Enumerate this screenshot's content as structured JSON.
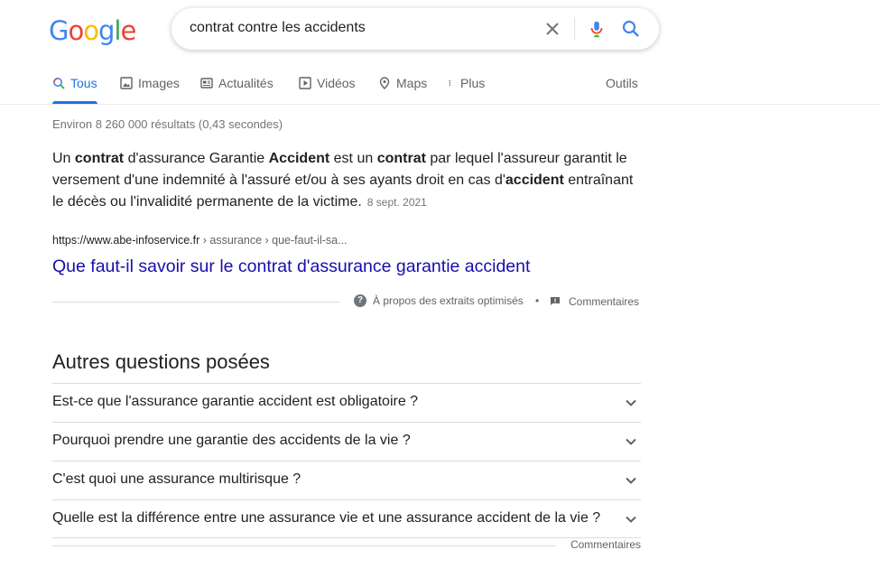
{
  "logo": {
    "text": "Google",
    "letters": [
      "G",
      "o",
      "o",
      "g",
      "l",
      "e"
    ],
    "colors": [
      "#4285f4",
      "#ea4335",
      "#fbbc05",
      "#4285f4",
      "#34a853",
      "#ea4335"
    ]
  },
  "search": {
    "query": "contrat contre les accidents",
    "icons": [
      "close-icon",
      "microphone-icon",
      "search-icon"
    ]
  },
  "tabs": [
    {
      "label": "Tous",
      "icon": "search-icon",
      "active": true
    },
    {
      "label": "Images",
      "icon": "image-icon"
    },
    {
      "label": "Actualités",
      "icon": "news-icon"
    },
    {
      "label": "Vidéos",
      "icon": "play-icon"
    },
    {
      "label": "Maps",
      "icon": "map-pin-icon"
    },
    {
      "label": "Plus",
      "icon": "more-vert-icon"
    }
  ],
  "tools_label": "Outils",
  "stats": "Environ 8 260 000 résultats (0,43 secondes)",
  "featured_snippet": {
    "parts": [
      {
        "t": "Un ",
        "b": false
      },
      {
        "t": "contrat",
        "b": true
      },
      {
        "t": " d'assurance Garantie ",
        "b": false
      },
      {
        "t": "Accident",
        "b": true
      },
      {
        "t": " est un ",
        "b": false
      },
      {
        "t": "contrat",
        "b": true
      },
      {
        "t": " par lequel l'assureur garantit le versement d'une indemnité à l'assuré et/ou à ses ayants droit en cas d'",
        "b": false
      },
      {
        "t": "accident",
        "b": true
      },
      {
        "t": " entraînant le décès ou l'invalidité permanente de la victime.",
        "b": false
      }
    ],
    "date": "8 sept. 2021",
    "url_host": "https://www.abe-infoservice.fr",
    "url_path": " › assurance › que-faut-il-sa...",
    "title": "Que faut-il savoir sur le contrat d'assurance garantie accident",
    "about_label": "À propos des extraits optimisés",
    "separator": "•",
    "comments_label": "Commentaires"
  },
  "paa": {
    "title": "Autres questions posées",
    "questions": [
      "Est-ce que l'assurance garantie accident est obligatoire ?",
      "Pourquoi prendre une garantie des accidents de la vie ?",
      "C'est quoi une assurance multirisque ?",
      "Quelle est la différence entre une assurance vie et une assurance accident de la vie ?"
    ],
    "comments_label": "Commentaires"
  },
  "colors": {
    "link": "#1a0dab",
    "accent": "#1a73e8",
    "muted": "#70757a"
  }
}
